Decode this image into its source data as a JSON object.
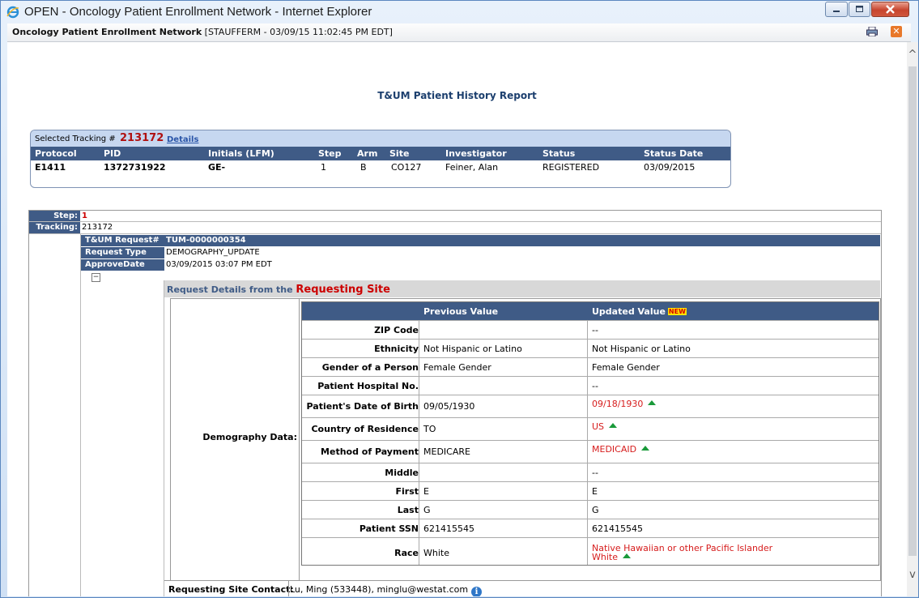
{
  "window": {
    "title": "OPEN - Oncology Patient Enrollment Network - Internet Explorer"
  },
  "infobar": {
    "app_name": "Oncology Patient Enrollment Network",
    "session": "[STAUFFERM - 03/09/15 11:02:45 PM EDT]"
  },
  "report": {
    "title": "T&UM Patient History Report"
  },
  "selected": {
    "label": "Selected Tracking #",
    "number": "213172",
    "details_link": "Details",
    "columns": [
      "Protocol",
      "PID",
      "Initials (LFM)",
      "Step",
      "Arm",
      "Site",
      "Investigator",
      "Status",
      "Status Date"
    ],
    "values": [
      "E1411",
      "1372731922",
      "GE-",
      "1",
      "B",
      "CO127",
      "Feiner, Alan",
      "REGISTERED",
      "03/09/2015"
    ]
  },
  "step": {
    "step_label": "Step:",
    "step_value": "1",
    "tracking_label": "Tracking:",
    "tracking_value": "213172"
  },
  "request": {
    "id_label": "T&UM Request#",
    "id_value": "TUM-0000000354",
    "type_label": "Request Type",
    "type_value": "DEMOGRAPHY_UPDATE",
    "approve_label": "ApproveDate",
    "approve_value": "03/09/2015 03:07 PM EDT",
    "details_prefix": "Request Details from the",
    "details_site": "Requesting Site",
    "demography_label": "Demography Data:",
    "col_previous": "Previous Value",
    "col_updated": "Updated Value",
    "new_badge": "NEW",
    "rows": [
      {
        "label": "ZIP Code",
        "previous": "",
        "updated": "--",
        "changed": false
      },
      {
        "label": "Ethnicity",
        "previous": "Not Hispanic or Latino",
        "updated": "Not Hispanic or Latino",
        "changed": false
      },
      {
        "label": "Gender of a Person",
        "previous": "Female Gender",
        "updated": "Female Gender",
        "changed": false
      },
      {
        "label": "Patient Hospital No.",
        "previous": "",
        "updated": "--",
        "changed": false
      },
      {
        "label": "Patient's Date of Birth",
        "previous": "09/05/1930",
        "updated": "09/18/1930",
        "changed": true
      },
      {
        "label": "Country of Residence",
        "previous": "TO",
        "updated": "US",
        "changed": true
      },
      {
        "label": "Method of Payment",
        "previous": "MEDICARE",
        "updated": "MEDICAID",
        "changed": true
      },
      {
        "label": "Middle",
        "previous": "",
        "updated": "--",
        "changed": false
      },
      {
        "label": "First",
        "previous": "E",
        "updated": "E",
        "changed": false
      },
      {
        "label": "Last",
        "previous": "G",
        "updated": "G",
        "changed": false
      },
      {
        "label": "Patient SSN",
        "previous": "621415545",
        "updated": "621415545",
        "changed": false
      },
      {
        "label": "Race",
        "previous": "White",
        "updated": "Native Hawaiian or other Pacific Islander",
        "updated_line2": "White",
        "changed": true
      }
    ],
    "contact_label": "Requesting Site Contact:",
    "contact_value": "Lu, Ming (533448), minglu@westat.com"
  },
  "colors": {
    "header_navy": "#3f5b86",
    "changed_red": "#d61c1c",
    "arrow_green": "#1a9a3a"
  }
}
